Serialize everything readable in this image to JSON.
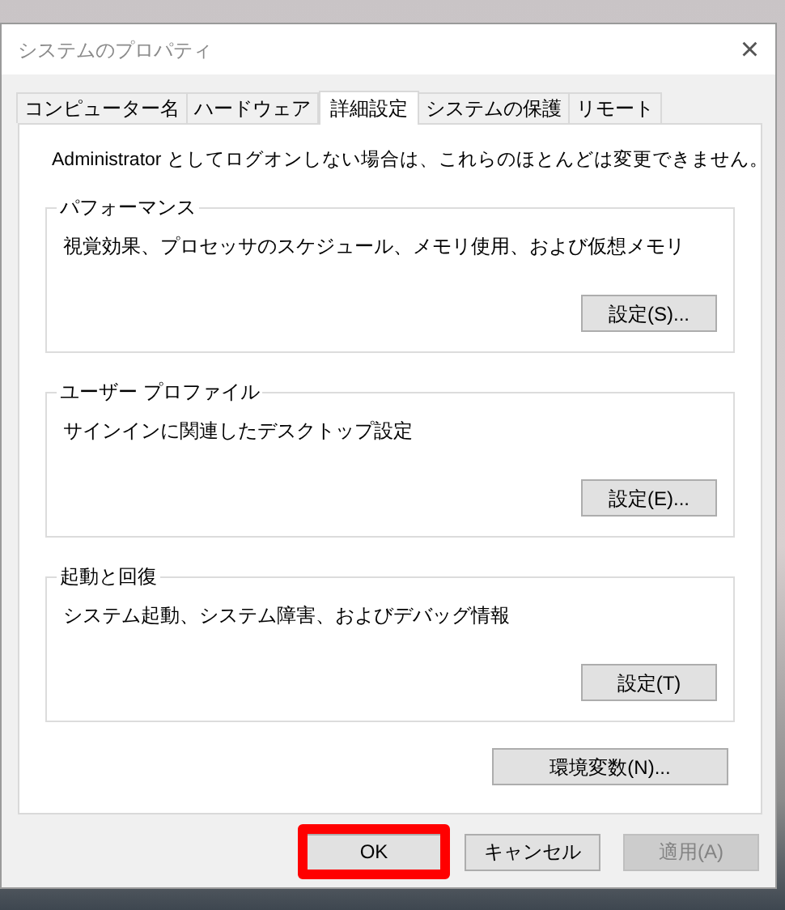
{
  "window": {
    "title": "システムのプロパティ",
    "close": "×"
  },
  "tabs": [
    {
      "label": "コンピューター名",
      "selected": false
    },
    {
      "label": "ハードウェア",
      "selected": false
    },
    {
      "label": "詳細設定",
      "selected": true
    },
    {
      "label": "システムの保護",
      "selected": false
    },
    {
      "label": "リモート",
      "selected": false
    }
  ],
  "notice": "Administrator としてログオンしない場合は、これらのほとんどは変更できません。",
  "groups": [
    {
      "title": "パフォーマンス",
      "description": "視覚効果、プロセッサのスケジュール、メモリ使用、および仮想メモリ",
      "button": "設定(S)..."
    },
    {
      "title": "ユーザー プロファイル",
      "description": "サインインに関連したデスクトップ設定",
      "button": "設定(E)..."
    },
    {
      "title": "起動と回復",
      "description": "システム起動、システム障害、およびデバッグ情報",
      "button": "設定(T)"
    }
  ],
  "env_button": "環境変数(N)...",
  "buttons": [
    {
      "label": "OK",
      "disabled": false,
      "highlighted": true
    },
    {
      "label": "キャンセル",
      "disabled": false,
      "highlighted": false
    },
    {
      "label": "適用(A)",
      "disabled": true,
      "highlighted": false
    }
  ]
}
